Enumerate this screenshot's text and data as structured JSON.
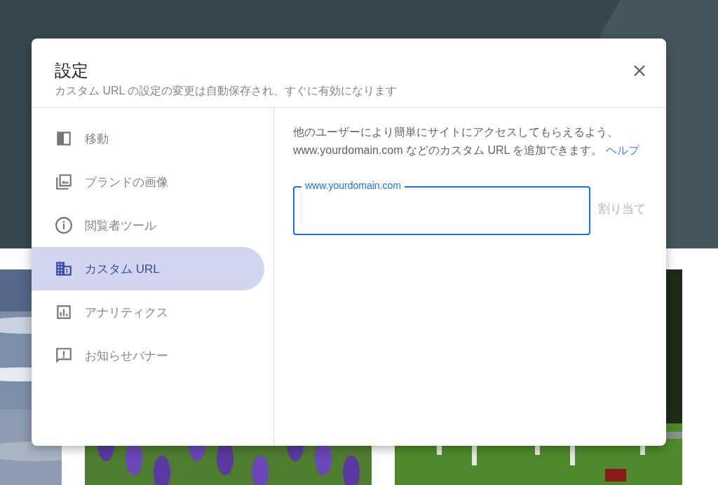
{
  "dialog": {
    "title": "設定",
    "subtitle": "カスタム URL の設定の変更は自動保存され、すぐに有効になります"
  },
  "sidebar": {
    "items": [
      {
        "label": "移動",
        "selected": false
      },
      {
        "label": "ブランドの画像",
        "selected": false
      },
      {
        "label": "閲覧者ツール",
        "selected": false
      },
      {
        "label": "カスタム URL",
        "selected": true
      },
      {
        "label": "アナリティクス",
        "selected": false
      },
      {
        "label": "お知らせバナー",
        "selected": false
      }
    ]
  },
  "content": {
    "description": "他のユーザーにより簡単にサイトにアクセスしてもらえるよう、www.yourdomain.com などのカスタム URL を追加できます。",
    "help_link": "ヘルプ",
    "url_field": {
      "label": "www.yourdomain.com",
      "focused": true
    },
    "assign_button": {
      "label": "割り当て",
      "disabled": true
    }
  }
}
